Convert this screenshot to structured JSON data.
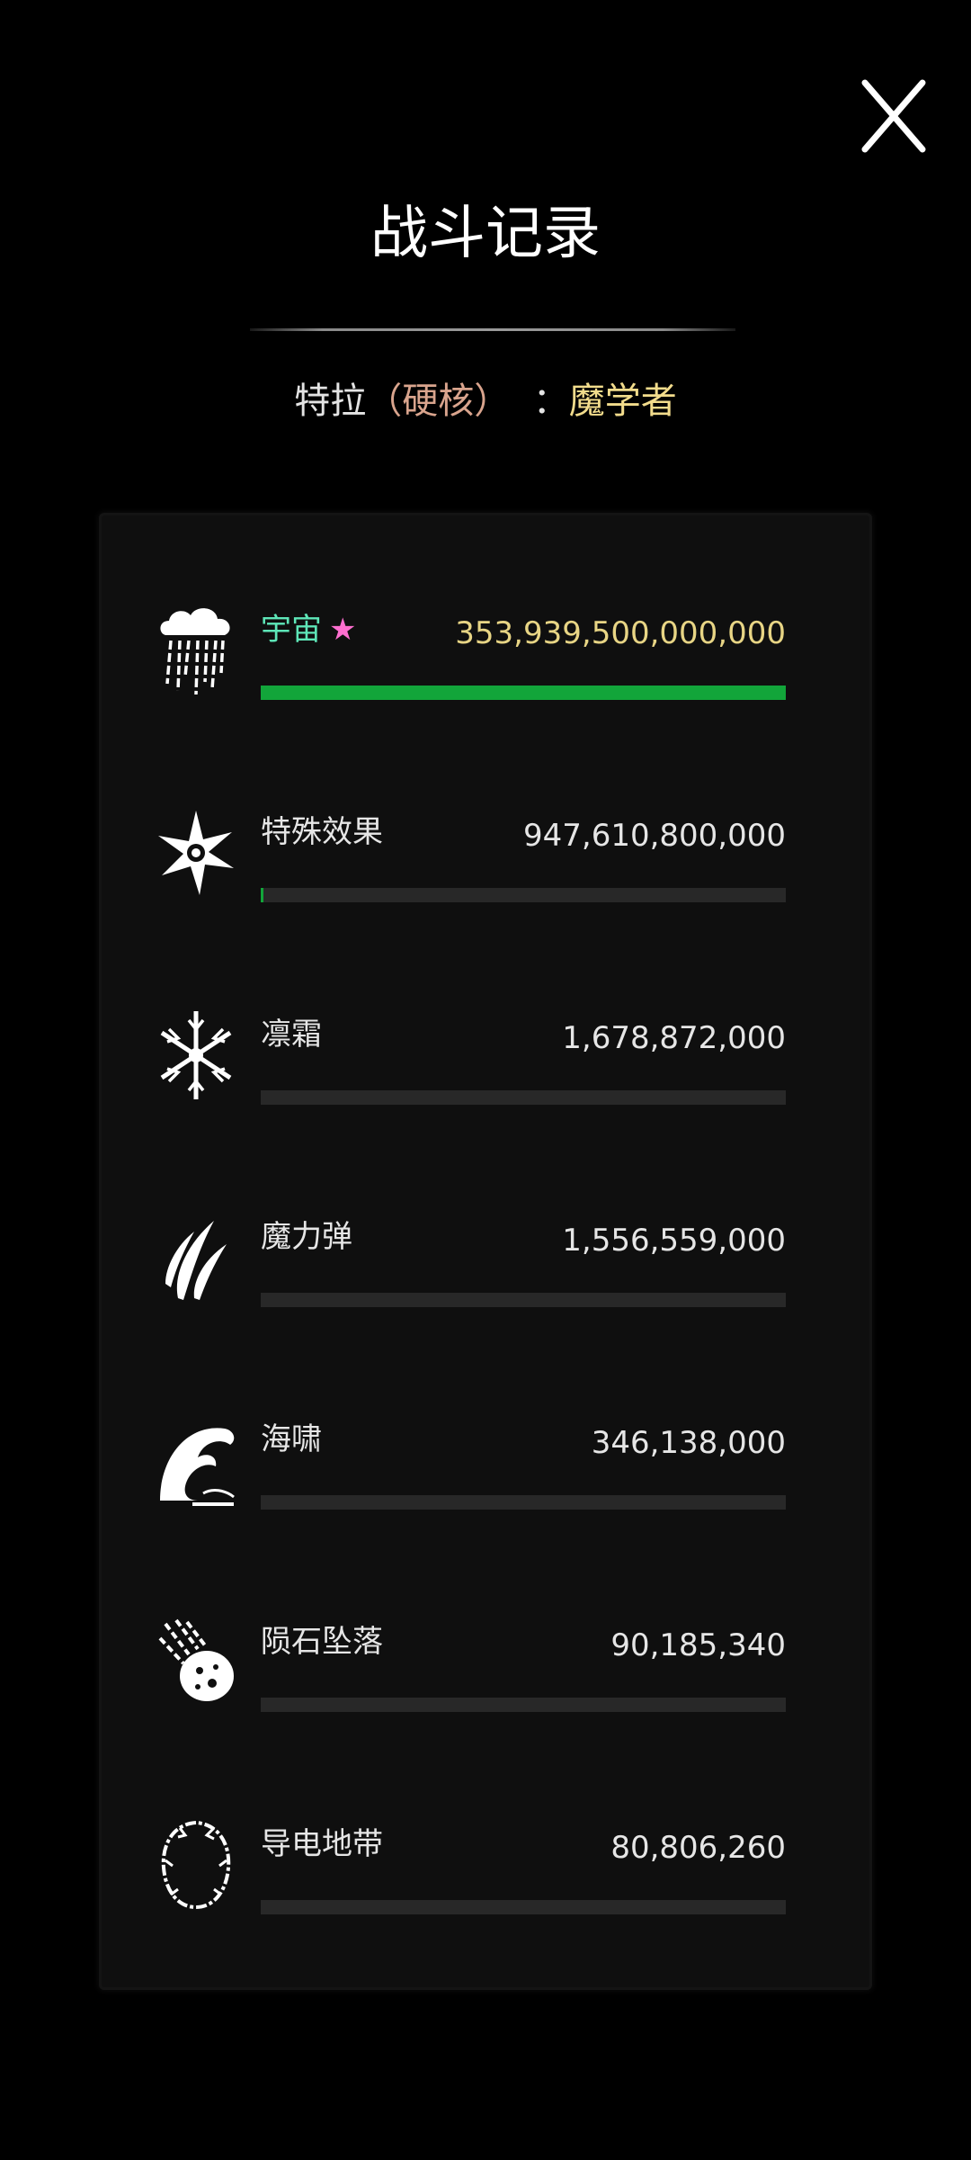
{
  "header": {
    "title": "战斗记录",
    "close_icon": "close-icon"
  },
  "subtitle": {
    "character": "特拉",
    "difficulty": "（硬核）",
    "separator": "  ：",
    "class": "魔学者"
  },
  "colors": {
    "accent_green": "#12a53a",
    "top_name": "#5ee6b8",
    "top_value": "#e8d585",
    "star": "#ff6fd0",
    "difficulty": "#d9a48d",
    "class": "#f2dc8c"
  },
  "records": [
    {
      "name": "宇宙",
      "star": "★",
      "value": "353,939,500,000,000",
      "progress": 1.0,
      "icon": "storm-cloud-icon"
    },
    {
      "name": "特殊效果",
      "star": "",
      "value": "947,610,800,000",
      "progress": 0.003,
      "icon": "burst-icon"
    },
    {
      "name": "凛霜",
      "star": "",
      "value": "1,678,872,000",
      "progress": 0.0,
      "icon": "snowflake-icon"
    },
    {
      "name": "魔力弹",
      "star": "",
      "value": "1,556,559,000",
      "progress": 0.0,
      "icon": "magic-missile-icon"
    },
    {
      "name": "海啸",
      "star": "",
      "value": "346,138,000",
      "progress": 0.0,
      "icon": "wave-icon"
    },
    {
      "name": "陨石坠落",
      "star": "",
      "value": "90,185,340",
      "progress": 0.0,
      "icon": "meteor-icon"
    },
    {
      "name": "导电地带",
      "star": "",
      "value": "80,806,260",
      "progress": 0.0,
      "icon": "electric-ring-icon"
    }
  ]
}
